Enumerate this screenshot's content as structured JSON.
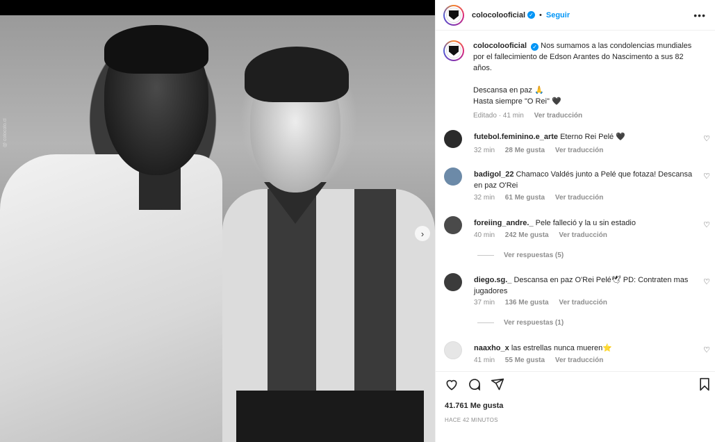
{
  "post": {
    "username": "colocolooficial",
    "follow_label": "Seguir",
    "dot": "•",
    "more": "•••",
    "next_arrow": "›",
    "watermark": "@ colocolo.cl",
    "caption": {
      "username": "colocolooficial",
      "text1": "Nos sumamos a las condolencias mundiales por el fallecimiento de Edson Arantes do Nascimento a sus 82 años.",
      "text2": "Descansa en paz 🙏",
      "text3": "Hasta siempre \"O Rei\" 🖤",
      "edited": "Editado · 41 min",
      "translate": "Ver traducción"
    },
    "likes": "41.761 Me gusta",
    "time_ago": "HACE 42 MINUTOS"
  },
  "comments": [
    {
      "username": "futebol.feminino.e_arte",
      "text": "Eterno Rei Pelé 🖤",
      "time": "32 min",
      "likes": "28 Me gusta",
      "translate": "Ver traducción",
      "avatar_color": "#2b2b2b"
    },
    {
      "username": "badigol_22",
      "text": "Chamaco Valdés junto a Pelé que fotaza! Descansa en paz O'Rei",
      "time": "32 min",
      "likes": "61 Me gusta",
      "translate": "Ver traducción",
      "avatar_color": "#6c8aa8"
    },
    {
      "username": "foreiing_andre._",
      "text": "Pele falleció y la u sin estadio",
      "time": "40 min",
      "likes": "242 Me gusta",
      "translate": "Ver traducción",
      "replies": "Ver respuestas (5)",
      "avatar_color": "#4a4a4a"
    },
    {
      "username": "diego.sg._",
      "text": "Descansa en paz O'Rei Pelé🕊 PD: Contraten mas jugadores",
      "time": "37 min",
      "likes": "136 Me gusta",
      "translate": "Ver traducción",
      "replies": "Ver respuestas (1)",
      "avatar_color": "#3b3b3b"
    },
    {
      "username": "naaxho_x",
      "text": "las estrellas nunca mueren⭐",
      "time": "41 min",
      "likes": "55 Me gusta",
      "translate": "Ver traducción",
      "avatar_color": "#e6e6e6"
    }
  ],
  "icons": {
    "heart": "heart-icon",
    "comment": "comment-icon",
    "share": "share-icon",
    "save": "bookmark-icon"
  },
  "colors": {
    "accent": "#0095f6",
    "muted": "#8e8e8e",
    "text": "#262626"
  }
}
